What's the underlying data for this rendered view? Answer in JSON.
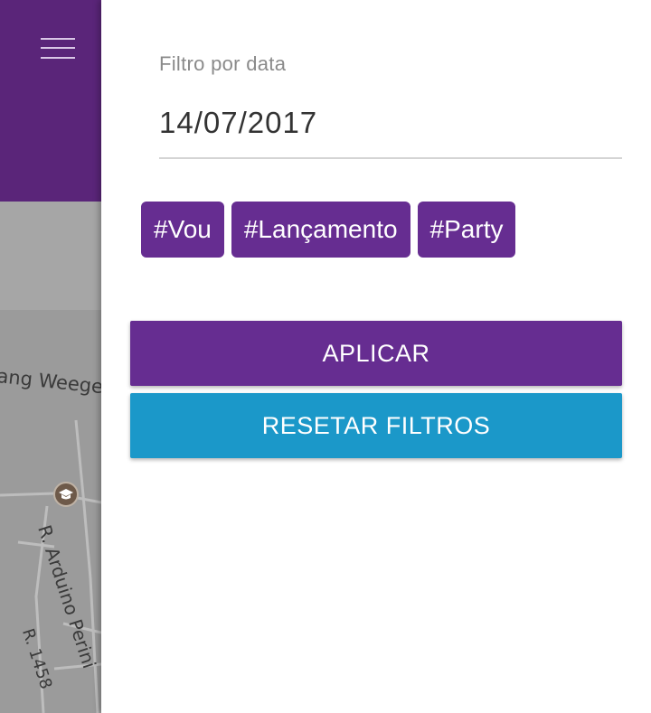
{
  "background": {
    "menu_icon": "hamburger-icon",
    "streets": [
      "ang Weege",
      "R. Arduino Perini",
      "R. 1458"
    ],
    "poi_icon": "graduation-cap-icon"
  },
  "drawer": {
    "date_filter": {
      "label": "Filtro por data",
      "value": "14/07/2017"
    },
    "tags": [
      "#Vou",
      "#Lançamento",
      "#Party"
    ],
    "apply_label": "APLICAR",
    "reset_label": "RESETAR FILTROS"
  },
  "colors": {
    "primary": "#662d91",
    "header_dark": "#5a2579",
    "reset": "#1b98c9"
  }
}
